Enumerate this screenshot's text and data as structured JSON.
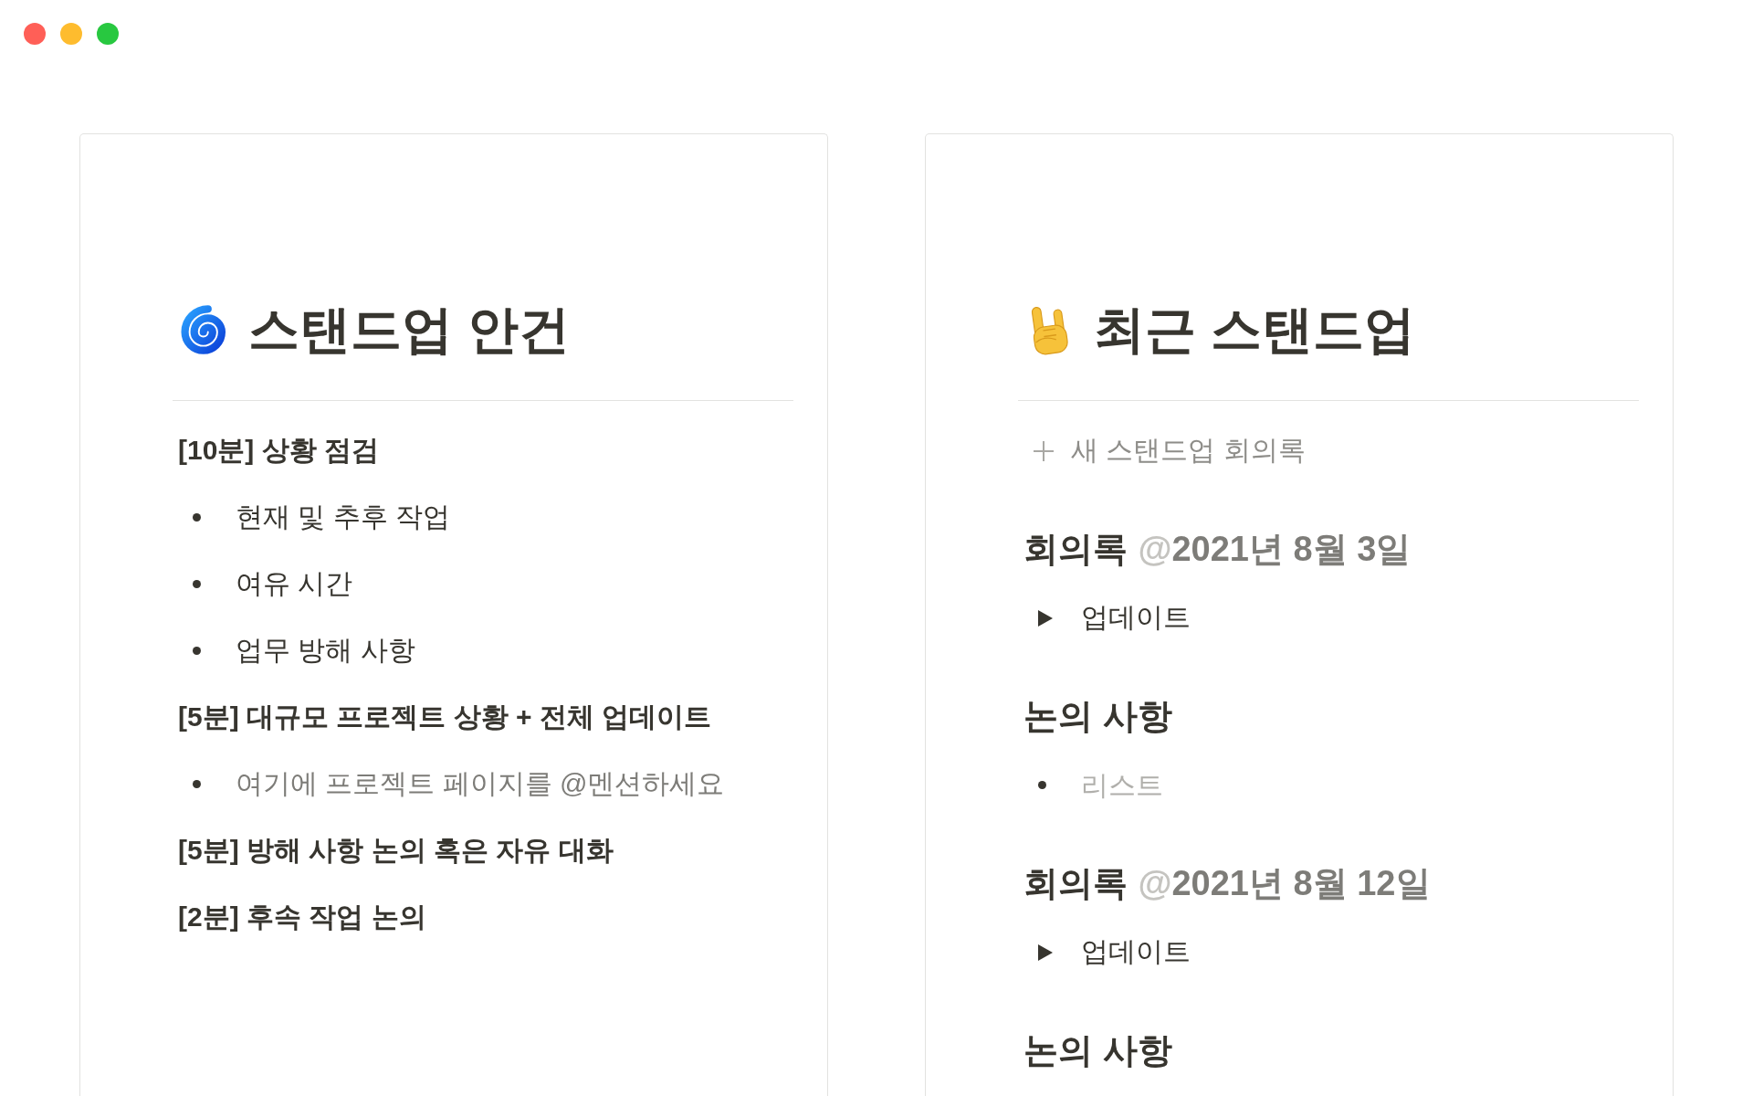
{
  "window": {
    "controls": [
      {
        "color": "#ff5f57"
      },
      {
        "color": "#febc2e"
      },
      {
        "color": "#28c840"
      }
    ]
  },
  "pages": [
    {
      "title": "스탠드업 안건",
      "blocks": [
        {
          "kind": "topic",
          "text": "[10분] 상황 점검"
        },
        {
          "kind": "bullet",
          "text": "현재 및 추후 작업",
          "muted": false
        },
        {
          "kind": "bullet",
          "text": "여유 시간",
          "muted": false
        },
        {
          "kind": "bullet",
          "text": "업무 방해 사항",
          "muted": false
        },
        {
          "kind": "topic",
          "text": "[5분] 대규모 프로젝트 상황 + 전체 업데이트"
        },
        {
          "kind": "bullet",
          "text": "여기에 프로젝트 페이지를 @멘션하세요",
          "muted": true
        },
        {
          "kind": "topic",
          "text": "[5분] 방해 사항 논의 혹은 자유 대화"
        },
        {
          "kind": "topic",
          "text": "[2분] 후속 작업 논의"
        }
      ]
    },
    {
      "title": "최근 스탠드업",
      "blocks": [
        {
          "kind": "new",
          "text": "새 스탠드업 회의록"
        },
        {
          "kind": "meeting",
          "title": "회의록",
          "mention": {
            "symbol": "@",
            "date": "2021년 8월 3일"
          }
        },
        {
          "kind": "toggle",
          "text": "업데이트",
          "expanded": false
        },
        {
          "kind": "heading",
          "text": "논의 사항"
        },
        {
          "kind": "bullet",
          "placeholder": "리스트"
        },
        {
          "kind": "meeting",
          "title": "회의록",
          "mention": {
            "symbol": "@",
            "date": "2021년 8월 12일"
          }
        },
        {
          "kind": "toggle",
          "text": "업데이트",
          "expanded": false
        },
        {
          "kind": "heading",
          "text": "논의 사항"
        }
      ]
    }
  ]
}
